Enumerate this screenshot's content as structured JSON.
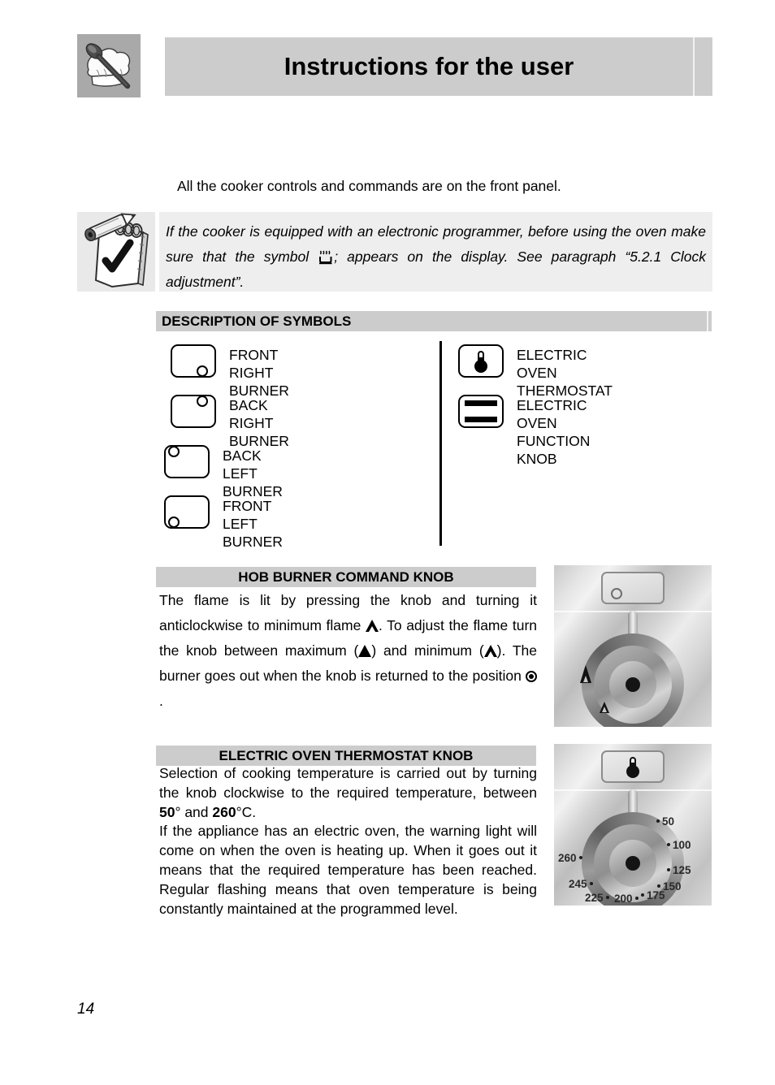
{
  "header": {
    "title": "Instructions for the user",
    "logo_icon": "chef-hat-spoon-icon"
  },
  "intro": {
    "text": "All the cooker controls and commands are on the front panel."
  },
  "note": {
    "icon": "notepad-pencil-check-icon",
    "part1": "If the cooker is equipped with an electronic programmer, before using the oven make sure that the symbol",
    "symbol_icon": "heat-steam-dish-icon",
    "part2": "; appears on the display. See paragraph “5.2.1 Clock adjustment”."
  },
  "symbols_section": {
    "heading": "DESCRIPTION OF SYMBOLS",
    "left_column": [
      {
        "icon": "burner-front-right-icon",
        "label": "FRONT RIGHT BURNER",
        "dot_position": "bottom-right"
      },
      {
        "icon": "burner-back-right-icon",
        "label": "BACK RIGHT BURNER",
        "dot_position": "top-right"
      },
      {
        "icon": "burner-back-left-icon",
        "label": "BACK LEFT BURNER",
        "dot_position": "top-left"
      },
      {
        "icon": "burner-front-left-icon",
        "label": "FRONT LEFT BURNER",
        "dot_position": "bottom-left"
      }
    ],
    "right_column": [
      {
        "icon": "thermometer-icon",
        "label": "ELECTRIC OVEN\nTHERMOSTAT"
      },
      {
        "icon": "oven-function-bars-icon",
        "label": "ELECTRIC OVEN\nFUNCTION KNOB"
      }
    ]
  },
  "hob_section": {
    "heading": "HOB BURNER COMMAND KNOB",
    "text_a": "The flame is lit by pressing the knob and turning it anticlockwise to minimum flame",
    "text_b": ". To adjust the flame turn the knob between maximum (",
    "text_c": ") and minimum (",
    "text_d": "). The burner goes out when the knob is returned to the position",
    "text_e": ".",
    "photo": {
      "plaque_icon": "burner-front-right-icon",
      "max_flame_icon": "solid-triangle-icon",
      "min_flame_icon": "outline-triangle-icon",
      "knob_icon": "rotary-knob-icon"
    }
  },
  "thermostat_section": {
    "heading": "ELECTRIC OVEN THERMOSTAT KNOB",
    "paragraph1_a": "Selection of cooking temperature is carried out by turning the knob clockwise to the required temperature, between ",
    "min_temp": "50",
    "paragraph1_b": "° and ",
    "max_temp": "260",
    "paragraph1_c": "°C.",
    "paragraph2": "If the appliance has an electric oven, the warning light will come on when the oven is heating up. When it goes out it means that the required temperature has been reached. Regular flashing means that oven temperature is being constantly maintained at the programmed level.",
    "photo": {
      "plaque_icon": "thermometer-icon",
      "knob_icon": "rotary-knob-icon",
      "temperature_marks": [
        "50",
        "100",
        "125",
        "150",
        "175",
        "200",
        "225",
        "245",
        "260"
      ]
    }
  },
  "footer": {
    "page_number": "14"
  },
  "colors": {
    "bar_gray": "#cccccc",
    "logo_gray": "#a9a9a9",
    "note_gray": "#e9e9e9",
    "text_black": "#000000"
  }
}
